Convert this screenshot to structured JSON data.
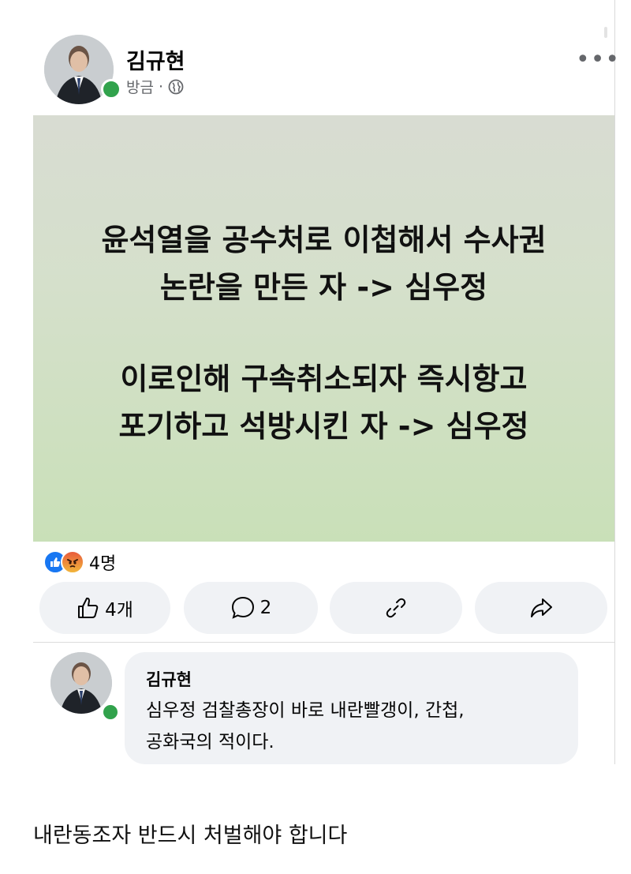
{
  "post": {
    "author_name": "김규현",
    "time_label": "방금",
    "separator": "·",
    "audience_icon": "globe-icon",
    "more_icon": "more-horizontal-icon",
    "more_label": "•••"
  },
  "banner": {
    "lines": [
      "윤석열을 공수처로 이첩해서 수사권",
      "논란을 만든 자 -> 심우정",
      "이로인해 구속취소되자 즉시항고",
      "포기하고 석방시킨 자 -> 심우정"
    ]
  },
  "reactions": {
    "icons": [
      "like-reaction-icon",
      "angry-reaction-icon"
    ],
    "count_label": "4명"
  },
  "actions": {
    "like_label": "4개",
    "comment_label": "2",
    "link_icon": "link-icon",
    "share_icon": "share-icon"
  },
  "comment": {
    "author_name": "김규현",
    "text_line1": "심우정 검찰총장이 바로 내란빨갱이, 간첩,",
    "text_line2": "공화국의 적이다."
  },
  "caption": "내란동조자 반드시 처벌해야 합니다",
  "colors": {
    "online": "#31a24c",
    "like_blue": "#1877f2",
    "button_bg": "#f0f2f5",
    "banner_green": "#c9e0b8"
  }
}
